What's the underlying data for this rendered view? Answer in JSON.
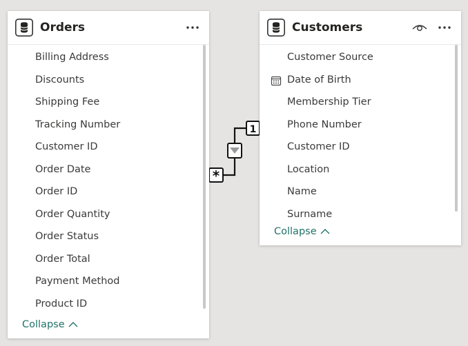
{
  "orders": {
    "title": "Orders",
    "fields": [
      "Billing Address",
      "Discounts",
      "Shipping Fee",
      "Tracking Number",
      "Customer ID",
      "Order Date",
      "Order ID",
      "Order Quantity",
      "Order Status",
      "Order Total",
      "Payment Method",
      "Product ID"
    ],
    "collapse_label": "Collapse"
  },
  "customers": {
    "title": "Customers",
    "fields": [
      {
        "label": "Customer Source",
        "icon": null
      },
      {
        "label": "Date of Birth",
        "icon": "calendar-icon"
      },
      {
        "label": "Membership Tier",
        "icon": null
      },
      {
        "label": "Phone Number",
        "icon": null
      },
      {
        "label": "Customer ID",
        "icon": null
      },
      {
        "label": "Location",
        "icon": null
      },
      {
        "label": "Name",
        "icon": null
      },
      {
        "label": "Surname",
        "icon": null
      }
    ],
    "collapse_label": "Collapse"
  },
  "relationship": {
    "one_side": "1",
    "many_side": "*",
    "direction_icon": "filter-direction-icon"
  },
  "colors": {
    "canvas": "#e5e4e2",
    "accent": "#21726a",
    "text": "#3b3a39"
  }
}
